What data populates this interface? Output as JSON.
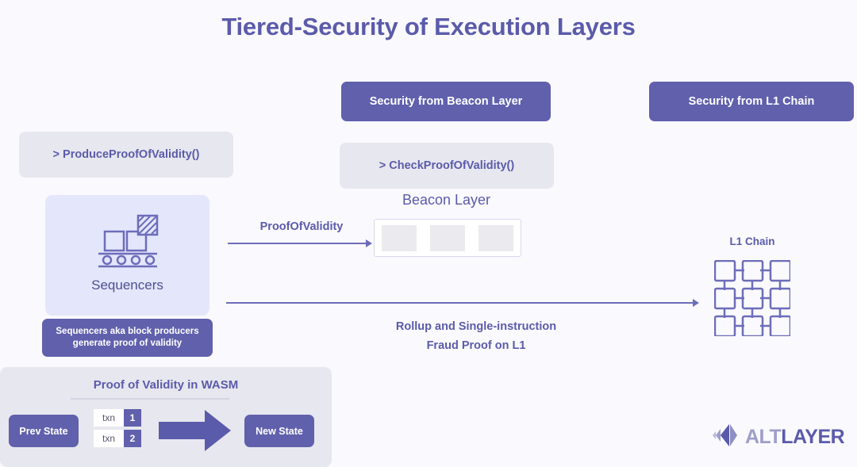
{
  "slide": {
    "title": "Tiered-Security of Execution Layers",
    "background_color": "#faf9fd",
    "accent_purple": "#6060ad",
    "text_purple": "#5b5bab"
  },
  "banners": {
    "beacon": "Security from Beacon Layer",
    "l1": "Security from L1 Chain"
  },
  "function_boxes": {
    "produce": "> ProduceProofOfValidity()",
    "check": "> CheckProofOfValidity()"
  },
  "sequencers": {
    "label": "Sequencers",
    "caption_line1": "Sequencers aka block producers",
    "caption_line2": "generate proof of validity",
    "icon": "conveyor-belt-blocks-icon"
  },
  "beacon_layer": {
    "title": "Beacon Layer",
    "blocks": [
      "",
      "",
      ""
    ]
  },
  "l1_chain": {
    "title": "L1 Chain",
    "grid_rows": 3,
    "grid_cols": 3
  },
  "arrows": {
    "proof_of_validity": "ProofOfValidity",
    "rollup_line1": "Rollup and Single-instruction",
    "rollup_line2": "Fraud Proof on L1"
  },
  "wasm_panel": {
    "title": "Proof of Validity in WASM",
    "prev_state": "Prev State",
    "new_state": "New State",
    "transactions": [
      {
        "label": "txn",
        "num": "1"
      },
      {
        "label": "txn",
        "num": "2"
      }
    ]
  },
  "logo": {
    "mark": "altlayer-diamond-icon",
    "text_first": "ALT",
    "text_second": "LAYER"
  }
}
